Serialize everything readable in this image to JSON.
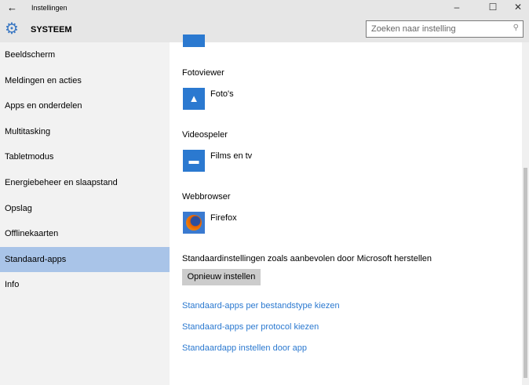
{
  "window": {
    "title": "Instellingen",
    "back": "←",
    "minimize": "–",
    "maximize": "☐",
    "close": "✕"
  },
  "header": {
    "title": "SYSTEEM",
    "search_placeholder": "Zoeken naar instelling"
  },
  "sidebar": {
    "items": [
      {
        "label": "Beeldscherm"
      },
      {
        "label": "Meldingen en acties"
      },
      {
        "label": "Apps en onderdelen"
      },
      {
        "label": "Multitasking"
      },
      {
        "label": "Tabletmodus"
      },
      {
        "label": "Energiebeheer en slaapstand"
      },
      {
        "label": "Opslag"
      },
      {
        "label": "Offlinekaarten"
      },
      {
        "label": "Standaard-apps",
        "active": true
      },
      {
        "label": "Info"
      }
    ]
  },
  "main": {
    "photo": {
      "heading": "Fotoviewer",
      "app": "Foto's"
    },
    "video": {
      "heading": "Videospeler",
      "app": "Films en tv"
    },
    "web": {
      "heading": "Webbrowser",
      "app": "Firefox"
    },
    "reset_text": "Standaardinstellingen zoals aanbevolen door Microsoft herstellen",
    "reset_button": "Opnieuw instellen",
    "links": [
      "Standaard-apps per bestandstype kiezen",
      "Standaard-apps per protocol kiezen",
      "Standaardapp instellen door app"
    ]
  }
}
